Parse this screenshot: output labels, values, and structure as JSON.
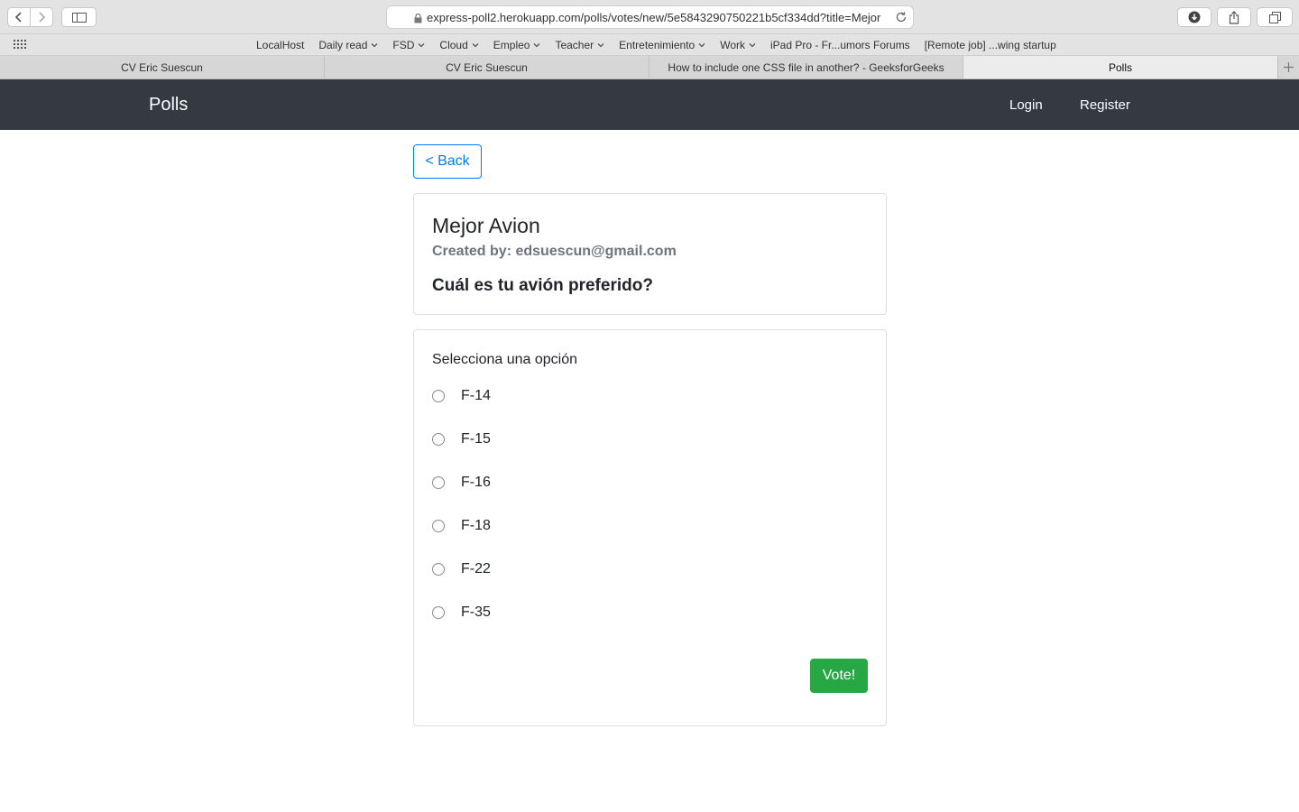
{
  "browser": {
    "url": "express-poll2.herokuapp.com/polls/votes/new/5e5843290750221b5cf334dd?title=Mejor",
    "bookmarks": [
      {
        "label": "LocalHost",
        "dropdown": false
      },
      {
        "label": "Daily read",
        "dropdown": true
      },
      {
        "label": "FSD",
        "dropdown": true
      },
      {
        "label": "Cloud",
        "dropdown": true
      },
      {
        "label": "Empleo",
        "dropdown": true
      },
      {
        "label": "Teacher",
        "dropdown": true
      },
      {
        "label": "Entretenimiento",
        "dropdown": true
      },
      {
        "label": "Work",
        "dropdown": true
      },
      {
        "label": "iPad Pro - Fr...umors Forums",
        "dropdown": false
      },
      {
        "label": "[Remote job] ...wing startup",
        "dropdown": false
      }
    ],
    "tabs": [
      {
        "label": "CV Eric Suescun",
        "active": false
      },
      {
        "label": "CV Eric Suescun",
        "active": false
      },
      {
        "label": "How to include one CSS file in another? - GeeksforGeeks",
        "active": false
      },
      {
        "label": "Polls",
        "active": true
      }
    ]
  },
  "navbar": {
    "brand": "Polls",
    "login": "Login",
    "register": "Register"
  },
  "back_button": "< Back",
  "poll": {
    "title": "Mejor Avion",
    "author": "Created by: edsuescun@gmail.com",
    "question": "Cuál es tu avión preferido?"
  },
  "vote_form": {
    "label": "Selecciona una opción",
    "options": [
      "F-14",
      "F-15",
      "F-16",
      "F-18",
      "F-22",
      "F-35"
    ],
    "submit": "Vote!"
  },
  "colors": {
    "navbar": "#343a40",
    "primary": "#007bff",
    "success": "#28a745"
  }
}
